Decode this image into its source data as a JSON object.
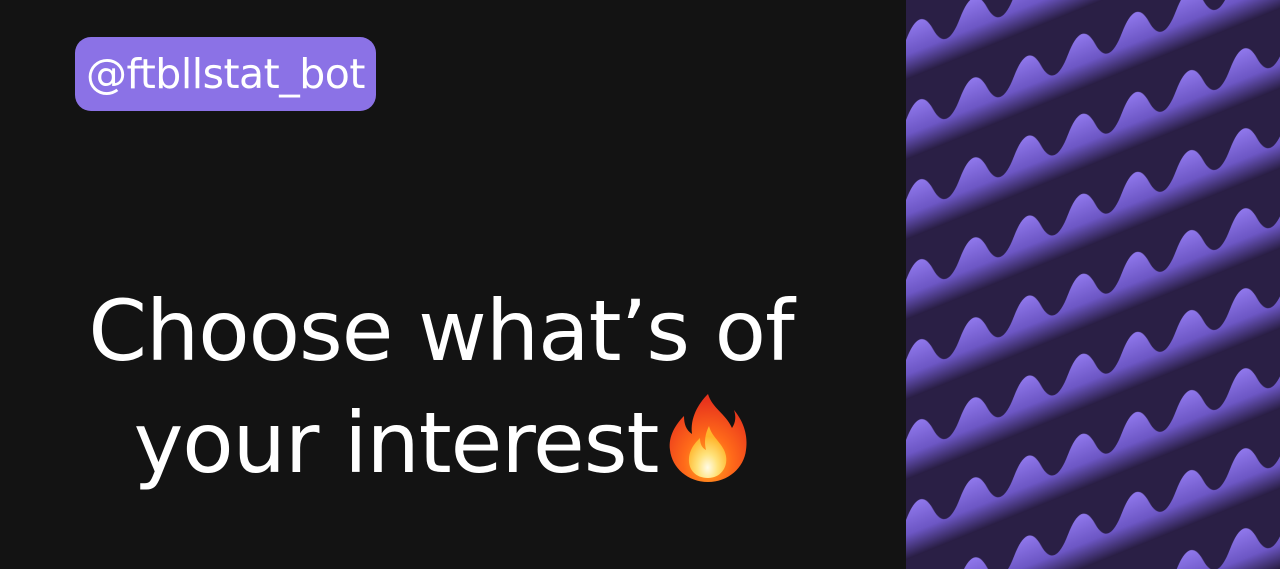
{
  "banner": {
    "handle": "@ftbllstat_bot",
    "headline_line1": "Choose what’s of",
    "headline_line2": "your interest",
    "emoji_icon": "fire-emoji-icon"
  },
  "colors": {
    "background": "#131313",
    "accent": "#8b72e6",
    "text": "#ffffff",
    "pattern_dark": "#2c2147",
    "pattern_light": "#8a72e8"
  }
}
